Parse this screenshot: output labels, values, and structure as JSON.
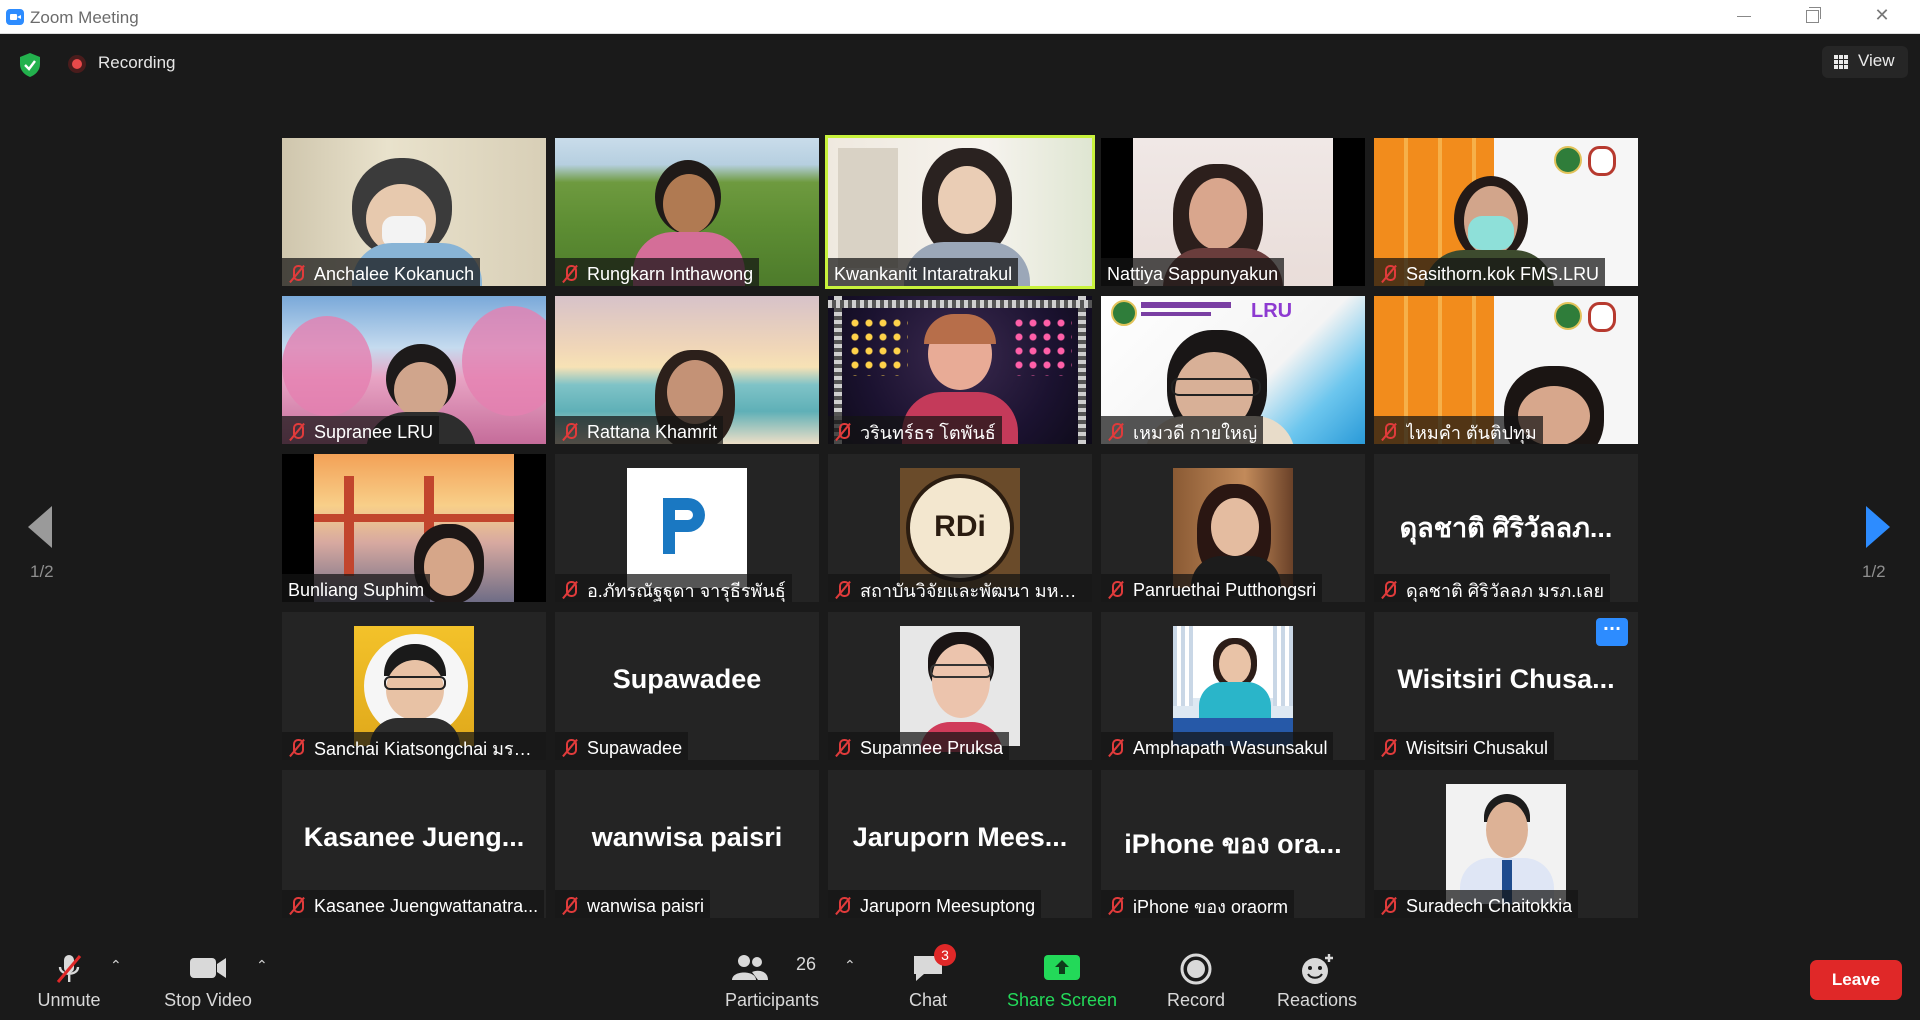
{
  "window": {
    "title": "Zoom Meeting"
  },
  "top_bar": {
    "recording_label": "Recording",
    "view_label": "View"
  },
  "pagination": {
    "left": "1/2",
    "right": "1/2"
  },
  "participants": [
    {
      "name": "Anchalee Kokanuch",
      "muted": true
    },
    {
      "name": "Rungkarn Inthawong",
      "muted": true
    },
    {
      "name": "Kwankanit Intaratrakul",
      "muted": false,
      "active": true
    },
    {
      "name": "Nattiya Sappunyakun",
      "muted": false
    },
    {
      "name": "Sasithorn.kok FMS.LRU",
      "muted": true
    },
    {
      "name": "Supranee LRU",
      "muted": true
    },
    {
      "name": "Rattana Khamrit",
      "muted": true
    },
    {
      "name": "วรินทร์ธร โตพันธ์",
      "muted": true
    },
    {
      "name": "เหมวดี  กายใหญ่",
      "muted": true
    },
    {
      "name": "ไหมคำ ตันติปทุม",
      "muted": true
    },
    {
      "name": "Bunliang Suphim",
      "muted": false
    },
    {
      "name": "อ.ภัทรณัฐฐุดา จารุธีรพันธุ์",
      "muted": true
    },
    {
      "name": "สถาบันวิจัยและพัฒนา มหาวิท...",
      "muted": true
    },
    {
      "name": "Panruethai Putthongsri",
      "muted": true
    },
    {
      "name": "ดุลชาติ ศิริวัลลภ มรภ.เลย",
      "muted": true,
      "big": "ดุลชาติ ศิริวัลลภ..."
    },
    {
      "name": "Sanchai Kiatsongchai มรภ...",
      "muted": true
    },
    {
      "name": "Supawadee",
      "muted": true,
      "big": "Supawadee"
    },
    {
      "name": "Supannee Pruksa",
      "muted": true
    },
    {
      "name": "Amphapath Wasunsakul",
      "muted": true
    },
    {
      "name": "Wisitsiri  Chusakul",
      "muted": true,
      "big": "Wisitsiri   Chusa..."
    },
    {
      "name": "Kasanee Juengwattanatra...",
      "muted": true,
      "big": "Kasanee  Jueng..."
    },
    {
      "name": "wanwisa paisri",
      "muted": true,
      "big": "wanwisa paisri"
    },
    {
      "name": "Jaruporn Meesuptong",
      "muted": true,
      "big": "Jaruporn  Mees..."
    },
    {
      "name": "iPhone ของ oraorm",
      "muted": true,
      "big": "iPhone ของ ora..."
    },
    {
      "name": "Suradech Chaitokkia",
      "muted": true
    }
  ],
  "logo_texts": {
    "rdi": "RDi"
  },
  "toolbar": {
    "unmute": "Unmute",
    "stop_video": "Stop Video",
    "participants": "Participants",
    "participants_count": "26",
    "chat": "Chat",
    "chat_badge": "3",
    "share_screen": "Share Screen",
    "record": "Record",
    "reactions": "Reactions",
    "leave": "Leave",
    "more_dots": "···"
  },
  "colors": {
    "accent": "#2d8cff",
    "active_speaker": "#c8f23c",
    "share_green": "#23d959",
    "leave_red": "#e02828",
    "muted_red": "#e03b3b"
  }
}
